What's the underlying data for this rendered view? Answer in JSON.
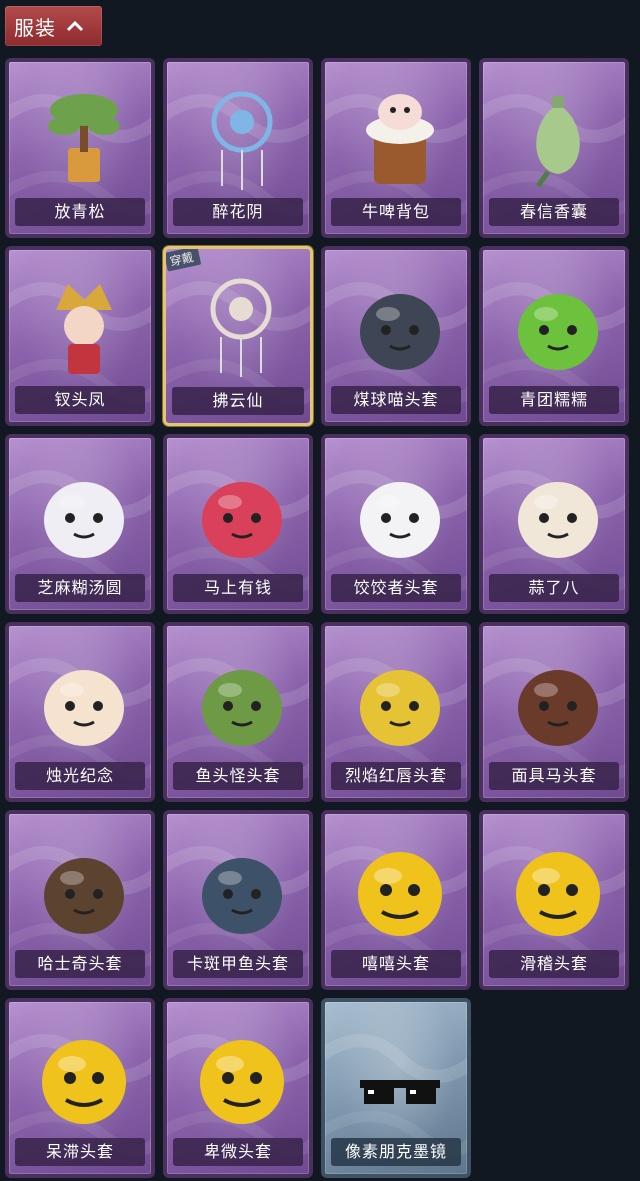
{
  "header": {
    "title": "服装",
    "icon": "chevron-up-icon"
  },
  "items": [
    {
      "name": "放青松",
      "icon": "pine-tree-pot",
      "color": "#6ea14b",
      "worn": false,
      "rare": false
    },
    {
      "name": "醉花阴",
      "icon": "dreamcatcher",
      "color": "#7fb6e6",
      "worn": false,
      "rare": false
    },
    {
      "name": "牛啤背包",
      "icon": "cow-beer-mug",
      "color": "#9a5a2e",
      "worn": false,
      "rare": false
    },
    {
      "name": "春信香囊",
      "icon": "green-sachet",
      "color": "#a8c98c",
      "worn": false,
      "rare": false
    },
    {
      "name": "钗头凤",
      "icon": "phoenix-crown-doll",
      "color": "#d9a83a",
      "worn": false,
      "rare": false
    },
    {
      "name": "拂云仙",
      "icon": "fairy-pendant",
      "color": "#e6dcd4",
      "worn": true,
      "badge": "穿戴",
      "rare": false
    },
    {
      "name": "煤球喵头套",
      "icon": "black-cat-head",
      "color": "#3e4554",
      "worn": false,
      "rare": false
    },
    {
      "name": "青团糯糯",
      "icon": "green-rice-ball",
      "color": "#6cc23c",
      "worn": false,
      "rare": false
    },
    {
      "name": "芝麻糊汤圆",
      "icon": "dumpling-ball",
      "color": "#eeeef4",
      "worn": false,
      "rare": false
    },
    {
      "name": "马上有钱",
      "icon": "red-horse-head",
      "color": "#d9405a",
      "worn": false,
      "rare": false
    },
    {
      "name": "饺饺者头套",
      "icon": "cloud-dumpling-head",
      "color": "#f3f3f6",
      "worn": false,
      "rare": false
    },
    {
      "name": "蒜了八",
      "icon": "garlic-head",
      "color": "#f1e7d9",
      "worn": false,
      "rare": false
    },
    {
      "name": "烛光纪念",
      "icon": "candle-head",
      "color": "#f5e2cf",
      "worn": false,
      "rare": false
    },
    {
      "name": "鱼头怪头套",
      "icon": "fish-head-mask",
      "color": "#6e9a45",
      "worn": false,
      "rare": false
    },
    {
      "name": "烈焰红唇头套",
      "icon": "yellow-mouse-head",
      "color": "#e5c335",
      "worn": false,
      "rare": false
    },
    {
      "name": "面具马头套",
      "icon": "horse-mask",
      "color": "#6a3a2a",
      "worn": false,
      "rare": false
    },
    {
      "name": "哈士奇头套",
      "icon": "husky-head",
      "color": "#5b4330",
      "worn": false,
      "rare": false
    },
    {
      "name": "卡斑甲鱼头套",
      "icon": "blue-fish-head",
      "color": "#3d5168",
      "worn": false,
      "rare": false
    },
    {
      "name": "嘻嘻头套",
      "icon": "grin-emoji-head",
      "color": "#f0c21c",
      "worn": false,
      "rare": false
    },
    {
      "name": "滑稽头套",
      "icon": "smirk-emoji-head",
      "color": "#f0c21c",
      "worn": false,
      "rare": false
    },
    {
      "name": "呆滞头套",
      "icon": "stare-emoji-head",
      "color": "#f0c21c",
      "worn": false,
      "rare": false
    },
    {
      "name": "卑微头套",
      "icon": "shy-emoji-head",
      "color": "#f0c21c",
      "worn": false,
      "rare": false
    },
    {
      "name": "像素朋克墨镜",
      "icon": "pixel-sunglasses",
      "color": "#111111",
      "worn": false,
      "rare": true
    }
  ]
}
